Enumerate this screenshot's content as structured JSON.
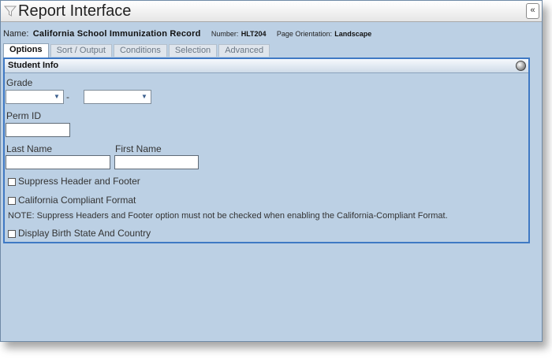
{
  "window": {
    "title": "Report Interface",
    "collapse_label": "«"
  },
  "report": {
    "name_label": "Name:",
    "name_value": "California School Immunization Record",
    "number_label": "Number:",
    "number_value": "HLT204",
    "orientation_label": "Page Orientation:",
    "orientation_value": "Landscape"
  },
  "tabs": [
    {
      "label": "Options",
      "active": true
    },
    {
      "label": "Sort / Output",
      "active": false
    },
    {
      "label": "Conditions",
      "active": false
    },
    {
      "label": "Selection",
      "active": false
    },
    {
      "label": "Advanced",
      "active": false
    }
  ],
  "panel": {
    "title": "Student Info"
  },
  "fields": {
    "grade_label": "Grade",
    "grade_from_value": "",
    "grade_separator": "-",
    "grade_to_value": "",
    "perm_id_label": "Perm ID",
    "perm_id_value": "",
    "last_name_label": "Last Name",
    "last_name_value": "",
    "first_name_label": "First Name",
    "first_name_value": ""
  },
  "options": {
    "suppress_header_footer": {
      "label": "Suppress Header and Footer",
      "checked": false
    },
    "california_compliant": {
      "label": "California Compliant Format",
      "checked": false
    },
    "note": "NOTE: Suppress Headers and Footer option must not be checked when enabling the California-Compliant Format.",
    "display_birth_state": {
      "label": "Display Birth State And Country",
      "checked": false
    }
  }
}
